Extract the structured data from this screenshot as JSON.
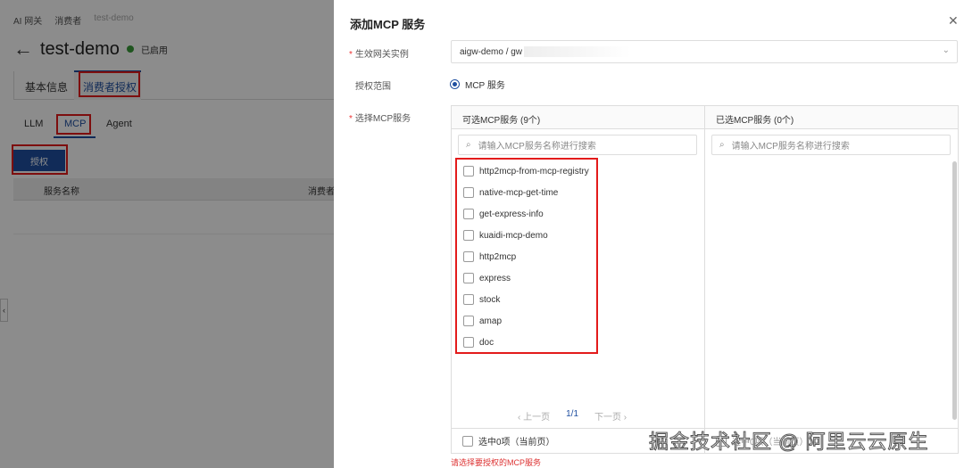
{
  "page": {
    "breadcrumb": [
      "AI 网关",
      "消费者",
      "test-demo"
    ],
    "title": "test-demo",
    "status": "已启用",
    "tabs": [
      "基本信息",
      "消费者授权"
    ],
    "subtabs": [
      "LLM",
      "MCP",
      "Agent"
    ],
    "authorize_button": "授权",
    "table_headers": [
      "服务名称",
      "消费者"
    ]
  },
  "modal": {
    "title": "添加MCP 服务",
    "gateway_label": "生效网关实例",
    "gateway_value": "aigw-demo / gw",
    "scope_label": "授权范围",
    "scope_option": "MCP 服务",
    "select_label": "选择MCP服务",
    "left_title": "可选MCP服务 (9个)",
    "right_title": "已选MCP服务 (0个)",
    "search_placeholder": "请输入MCP服务名称进行搜索",
    "items": [
      "http2mcp-from-mcp-registry",
      "native-mcp-get-time",
      "get-express-info",
      "kuaidi-mcp-demo",
      "http2mcp",
      "express",
      "stock",
      "amap",
      "doc"
    ],
    "prev": "上一页",
    "page": "1/1",
    "next": "下一页",
    "footer_left": "选中0项（当前页）",
    "footer_right": "选中0项（当前页）",
    "error": "请选择要授权的MCP服务"
  },
  "watermark": "掘金技术社区 @ 阿里云云原生",
  "colors": {
    "primary": "#1f4fa0",
    "highlight": "#e31b1b",
    "success": "#3a9b3a"
  }
}
